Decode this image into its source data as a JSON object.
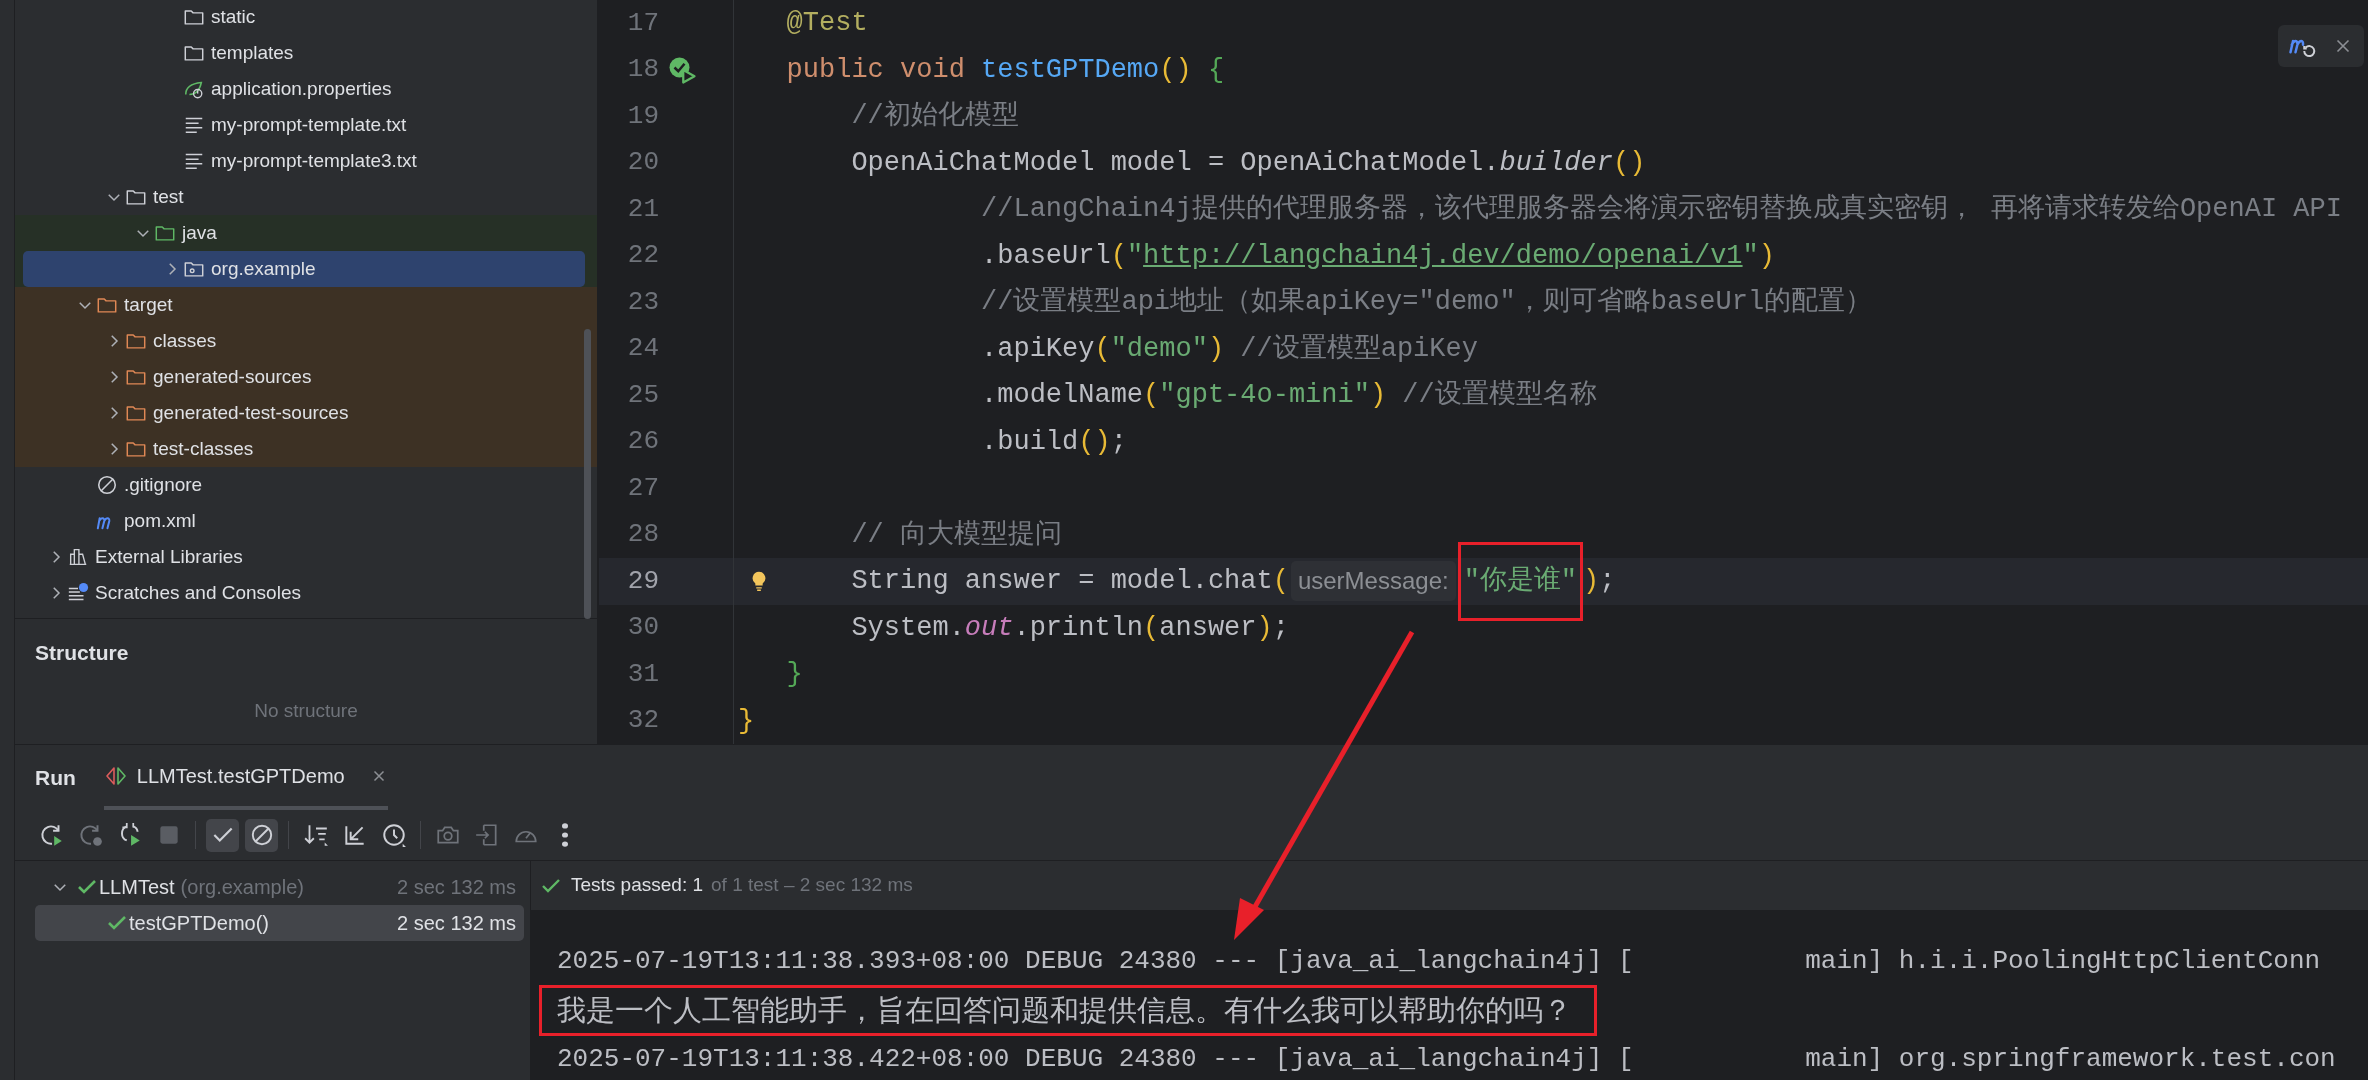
{
  "project_tree": [
    {
      "children": [
        {
          "children": [
            {
              "children": [
                {
                  "children": [
                    {
                      "label": "static",
                      "kind": "folder",
                      "selected": false
                    },
                    {
                      "label": "templates",
                      "kind": "folder",
                      "selected": false
                    },
                    {
                      "label": "application.properties",
                      "kind": "spring-config",
                      "selected": false
                    },
                    {
                      "label": "my-prompt-template.txt",
                      "kind": "text-file",
                      "selected": false
                    },
                    {
                      "label": "my-prompt-template3.txt",
                      "kind": "text-file",
                      "selected": false
                    }
                  ]
                }
              ]
            },
            {
              "label": "test",
              "kind": "folder",
              "expanded": true,
              "selected": false,
              "children": [
                {
                  "label": "java",
                  "kind": "test-folder",
                  "expanded": true,
                  "selected": false,
                  "children": [
                    {
                      "label": "org.example",
                      "kind": "test-package",
                      "expanded": false,
                      "selected": true
                    }
                  ]
                }
              ]
            }
          ]
        },
        {
          "label": "target",
          "kind": "excluded-folder",
          "expanded": true,
          "selected": false,
          "children": [
            {
              "label": "classes",
              "kind": "excluded-folder",
              "expanded": false,
              "selected": false
            },
            {
              "label": "generated-sources",
              "kind": "excluded-folder",
              "expanded": false,
              "selected": false
            },
            {
              "label": "generated-test-sources",
              "kind": "excluded-folder",
              "expanded": false,
              "selected": false
            },
            {
              "label": "test-classes",
              "kind": "excluded-folder",
              "expanded": false,
              "selected": false
            }
          ]
        },
        {
          "label": ".gitignore",
          "kind": "gitignore",
          "selected": false
        },
        {
          "label": "pom.xml",
          "kind": "maven",
          "selected": false
        }
      ]
    },
    {
      "label": "External Libraries",
      "kind": "libraries",
      "expanded": false,
      "selected": false
    },
    {
      "label": "Scratches and Consoles",
      "kind": "scratches",
      "expanded": false,
      "selected": false
    }
  ],
  "structure": {
    "title": "Structure",
    "empty_text": "No structure"
  },
  "editor": {
    "floating_toolbar": [
      {
        "kind": "maven-reload"
      },
      {
        "kind": "close"
      }
    ],
    "lines": [
      {
        "number": "17",
        "kind": "code",
        "tokens": [
          {
            "kind": "annotation",
            "text": "   @Test"
          }
        ]
      },
      {
        "number": "18",
        "kind": "test-method",
        "tokens": [
          {
            "kind": "keyword",
            "text": "   public void "
          },
          {
            "kind": "method",
            "text": "testGPTDemo"
          },
          {
            "kind": "bracket",
            "text": "()",
            "color": "#e8ba36"
          },
          {
            "kind": "bracket",
            "text": " {",
            "color": "#54a857"
          }
        ]
      },
      {
        "number": "19",
        "kind": "code",
        "tokens": [
          {
            "kind": "comment",
            "text": "       //初始化模型"
          }
        ]
      },
      {
        "number": "20",
        "kind": "code",
        "tokens": [
          {
            "kind": "plain",
            "text": "       OpenAiChatModel model = OpenAiChatModel."
          },
          {
            "kind": "italic",
            "text": "builder"
          },
          {
            "kind": "bracket",
            "text": "()",
            "color": "#e8ba36"
          }
        ]
      },
      {
        "number": "21",
        "kind": "code",
        "tokens": [
          {
            "kind": "comment",
            "text": "               //LangChain4j提供的代理服务器，该代理服务器会将演示密钥替换成真实密钥， 再将请求转发给OpenAI API"
          }
        ]
      },
      {
        "number": "22",
        "kind": "code",
        "tokens": [
          {
            "kind": "plain",
            "text": "               .baseUrl"
          },
          {
            "kind": "bracket",
            "text": "(",
            "color": "#e8ba36"
          },
          {
            "kind": "string",
            "text": "\""
          },
          {
            "kind": "url",
            "text": "http://langchain4j.dev/demo/openai/v1"
          },
          {
            "kind": "string",
            "text": "\""
          },
          {
            "kind": "bracket",
            "text": ")",
            "color": "#e8ba36"
          }
        ]
      },
      {
        "number": "23",
        "kind": "code",
        "tokens": [
          {
            "kind": "comment",
            "text": "               //设置模型api地址（如果apiKey=\"demo\"，则可省略baseUrl的配置）"
          }
        ]
      },
      {
        "number": "24",
        "kind": "code",
        "tokens": [
          {
            "kind": "plain",
            "text": "               .apiKey"
          },
          {
            "kind": "bracket",
            "text": "(",
            "color": "#e8ba36"
          },
          {
            "kind": "string",
            "text": "\"demo\""
          },
          {
            "kind": "bracket",
            "text": ")",
            "color": "#e8ba36"
          },
          {
            "kind": "comment",
            "text": " //设置模型apiKey"
          }
        ]
      },
      {
        "number": "25",
        "kind": "code",
        "tokens": [
          {
            "kind": "plain",
            "text": "               .modelName"
          },
          {
            "kind": "bracket",
            "text": "(",
            "color": "#e8ba36"
          },
          {
            "kind": "string",
            "text": "\"gpt-4o-mini\""
          },
          {
            "kind": "bracket",
            "text": ")",
            "color": "#e8ba36"
          },
          {
            "kind": "comment",
            "text": " //设置模型名称"
          }
        ]
      },
      {
        "number": "26",
        "kind": "code",
        "tokens": [
          {
            "kind": "plain",
            "text": "               .build"
          },
          {
            "kind": "bracket",
            "text": "()",
            "color": "#e8ba36"
          },
          {
            "kind": "plain",
            "text": ";"
          }
        ]
      },
      {
        "number": "27",
        "kind": "code"
      },
      {
        "number": "28",
        "kind": "code",
        "tokens": [
          {
            "kind": "comment",
            "text": "       // 向大模型提问"
          }
        ]
      },
      {
        "number": "29",
        "kind": "intention",
        "current": true,
        "tokens": [
          {
            "kind": "plain",
            "text": "       String answer = model.chat"
          },
          {
            "kind": "bracket",
            "text": "(",
            "color": "#e8ba36"
          },
          {
            "kind": "hint",
            "text": "userMessage:"
          },
          {
            "kind": "marked-string",
            "text": "\"你是谁\""
          },
          {
            "kind": "bracket",
            "text": ")",
            "color": "#e8ba36"
          },
          {
            "kind": "plain",
            "text": ";"
          }
        ]
      },
      {
        "number": "30",
        "kind": "code",
        "tokens": [
          {
            "kind": "plain",
            "text": "       System."
          },
          {
            "kind": "static",
            "text": "out"
          },
          {
            "kind": "plain",
            "text": ".println"
          },
          {
            "kind": "bracket",
            "text": "(",
            "color": "#e8ba36"
          },
          {
            "kind": "plain",
            "text": "answer"
          },
          {
            "kind": "bracket",
            "text": ")",
            "color": "#e8ba36"
          },
          {
            "kind": "plain",
            "text": ";"
          }
        ]
      },
      {
        "number": "31",
        "kind": "code",
        "tokens": [
          {
            "kind": "bracket",
            "text": "   }",
            "color": "#54a857"
          }
        ]
      },
      {
        "number": "32",
        "kind": "code",
        "tokens": [
          {
            "kind": "bracket",
            "text": "}",
            "color": "#e8ba36"
          }
        ]
      }
    ]
  },
  "run_panel": {
    "title": "Run",
    "tabs": [
      {
        "label": "LLMTest.testGPTDemo",
        "selected": true
      }
    ],
    "toolbar": [
      {
        "kind": "rerun",
        "disabled": false,
        "on": false
      },
      {
        "kind": "rerun-failed",
        "disabled": true,
        "on": false
      },
      {
        "kind": "auto-rerun",
        "disabled": false,
        "on": false
      },
      {
        "kind": "stop",
        "disabled": true,
        "on": false
      },
      {
        "kind": "separator"
      },
      {
        "kind": "show-passed",
        "disabled": false,
        "on": true
      },
      {
        "kind": "show-ignored",
        "disabled": false,
        "on": true
      },
      {
        "kind": "separator"
      },
      {
        "kind": "sort",
        "disabled": false,
        "on": false
      },
      {
        "kind": "import",
        "disabled": false,
        "on": false
      },
      {
        "kind": "history",
        "disabled": false,
        "on": false
      },
      {
        "kind": "separator"
      },
      {
        "kind": "screenshot",
        "disabled": true,
        "on": false
      },
      {
        "kind": "export",
        "disabled": true,
        "on": false
      },
      {
        "kind": "profile",
        "disabled": true,
        "on": false
      },
      {
        "kind": "more",
        "disabled": false,
        "on": false
      }
    ],
    "tests": [
      {
        "name": "LLMTest",
        "detail": "(org.example)",
        "time": "2 sec 132 ms",
        "kind": "passed",
        "expanded": true,
        "selected": false,
        "children": [
          {
            "name": "testGPTDemo()",
            "time": "2 sec 132 ms",
            "kind": "passed",
            "selected": true
          }
        ]
      }
    ],
    "summary": {
      "kind": "passed",
      "headline": "Tests passed: 1",
      "detail": "of 1 test – 2 sec 132 ms"
    },
    "console": [
      {
        "kind": "log",
        "highlighted": false,
        "text": "2025-07-19T13:11:38.393+08:00 DEBUG 24380 --- [java_ai_langchain4j] [           main] h.i.i.PoolingHttpClientConn"
      },
      {
        "kind": "output",
        "highlighted": true,
        "text": "我是一个人工智能助手，旨在回答问题和提供信息。有什么我可以帮助你的吗？"
      },
      {
        "kind": "log",
        "highlighted": false,
        "text": "2025-07-19T13:11:38.422+08:00 DEBUG 24380 --- [java_ai_langchain4j] [           main] org.springframework.test.con"
      }
    ]
  }
}
